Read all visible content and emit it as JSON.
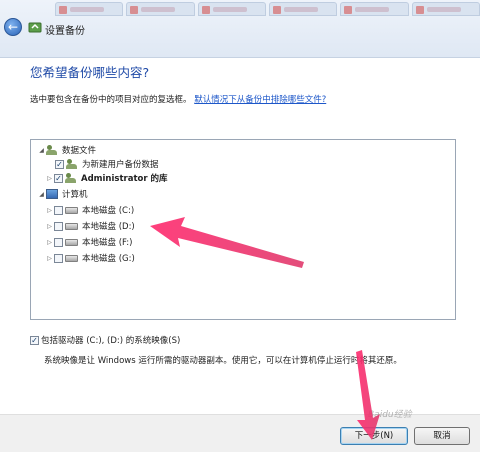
{
  "window": {
    "title": "设置备份"
  },
  "header": {
    "question": "您希望备份哪些内容?",
    "instruction": "选中要包含在备份中的项目对应的复选框。",
    "link": "默认情况下从备份中排除哪些文件?"
  },
  "tree": {
    "data_files": {
      "label": "数据文件"
    },
    "new_users": {
      "label": "为新建用户备份数据",
      "checked": true
    },
    "admin_lib": {
      "label": "Administrator 的库",
      "checked": true
    },
    "computer": {
      "label": "计算机"
    },
    "drives": [
      {
        "label": "本地磁盘 (C:)",
        "checked": false
      },
      {
        "label": "本地磁盘 (D:)",
        "checked": false
      },
      {
        "label": "本地磁盘 (F:)",
        "checked": false
      },
      {
        "label": "本地磁盘 (G:)",
        "checked": false
      }
    ]
  },
  "options": {
    "include_image": "包括驱动器 (C:), (D:) 的系统映像(S)",
    "include_image_checked": true,
    "image_info": "系统映像是让 Windows 运行所需的驱动器副本。使用它，可以在计算机停止运行时将其还原。"
  },
  "footer": {
    "next": "下一步(N)",
    "cancel": "取消",
    "watermark": "Baidu经验"
  },
  "colors": {
    "heading": "#1f4aa7",
    "link": "#1d57c9",
    "arrow": "#e8306a"
  }
}
